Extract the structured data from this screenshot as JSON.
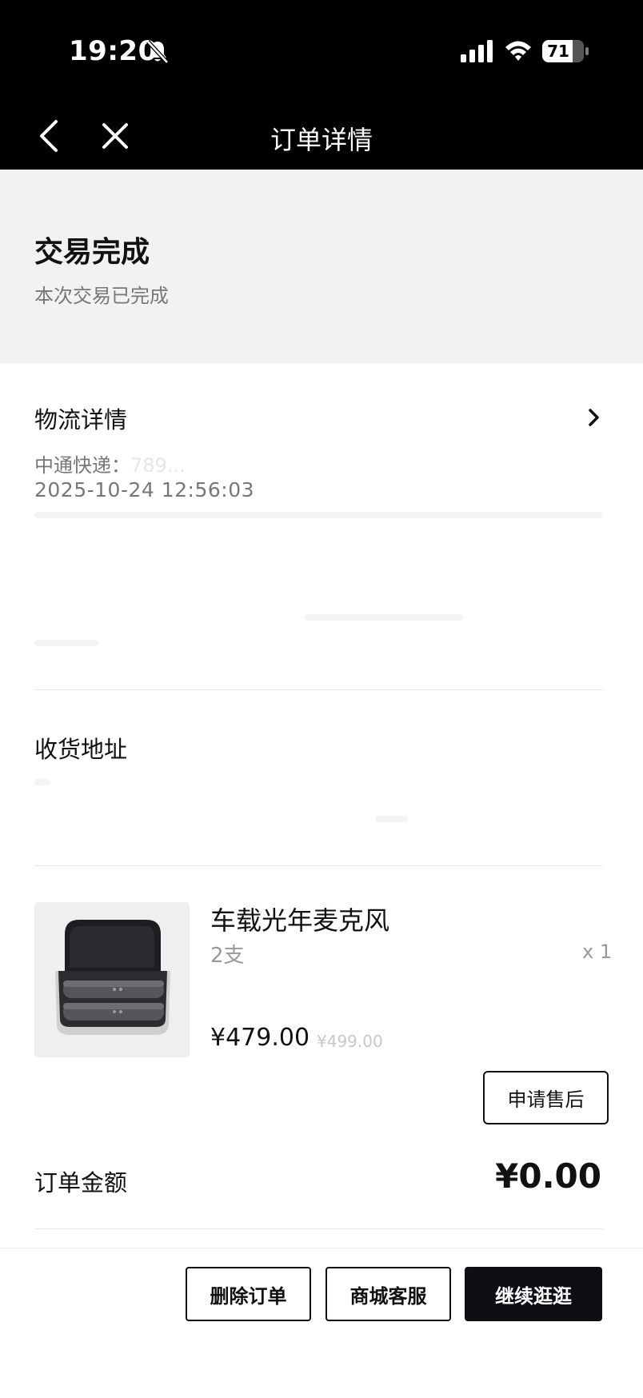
{
  "status_bar": {
    "time": "19:20",
    "battery": "71",
    "icons": [
      "bell-slash-icon",
      "cellular-signal-icon",
      "wifi-icon",
      "battery-icon"
    ]
  },
  "nav": {
    "title": "订单详情",
    "back_icon": "chevron-left-icon",
    "close_icon": "close-icon"
  },
  "order_status": {
    "title": "交易完成",
    "subtitle": "本次交易已完成"
  },
  "logistics": {
    "title": "物流详情",
    "carrier": "中通快递：",
    "tracking_partial": "789...",
    "time": "2025-10-24 12:56:03",
    "chevron_icon": "chevron-right-icon"
  },
  "address": {
    "title": "收货地址"
  },
  "product": {
    "name": "车载光年麦克风",
    "variant": "2支",
    "quantity": "x 1",
    "price": "¥479.00",
    "original_price": "¥499.00",
    "aftersale_label": "申请售后"
  },
  "order_amount": {
    "label": "订单金额",
    "value": "¥0.00"
  },
  "bottom_actions": {
    "delete_label": "删除订单",
    "service_label": "商城客服",
    "continue_label": "继续逛逛"
  },
  "colors": {
    "header_bg": "#000000",
    "status_section_bg": "#f2f2f2",
    "primary_button_bg": "#0e0f14",
    "muted_text": "#777777"
  }
}
